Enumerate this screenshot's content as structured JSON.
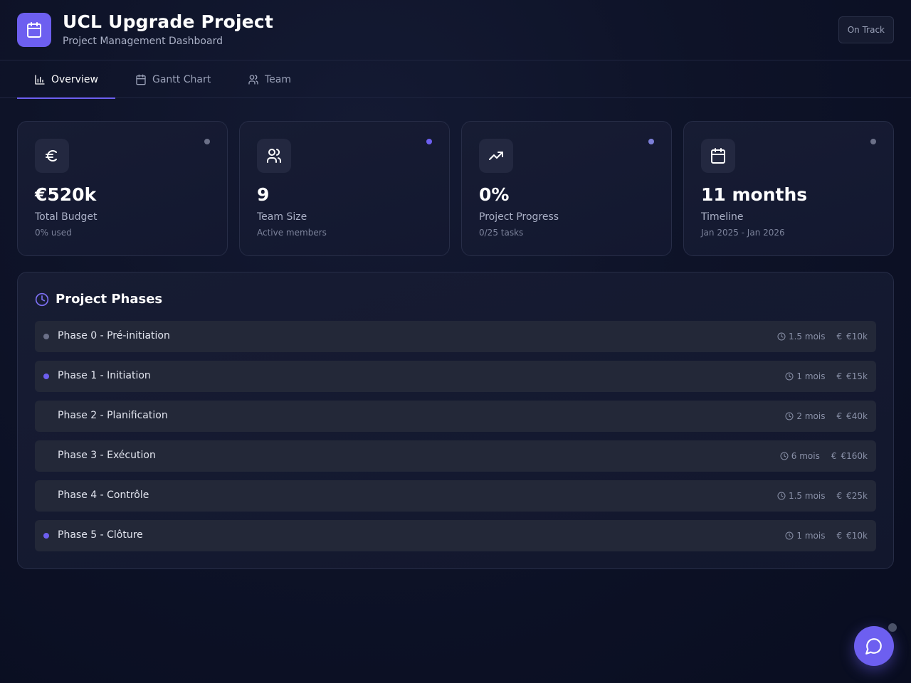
{
  "header": {
    "title": "UCL Upgrade Project",
    "subtitle": "Project Management Dashboard",
    "status": "On Track",
    "logo_icon": "calendar-icon"
  },
  "tabs": [
    {
      "label": "Overview",
      "icon": "bar-chart-icon",
      "active": true
    },
    {
      "label": "Gantt Chart",
      "icon": "calendar-icon",
      "active": false
    },
    {
      "label": "Team",
      "icon": "users-icon",
      "active": false
    }
  ],
  "stats": [
    {
      "icon": "euro-icon",
      "value": "€520k",
      "label": "Total Budget",
      "sub": "0% used",
      "dot_color": "#6b7088"
    },
    {
      "icon": "users-icon",
      "value": "9",
      "label": "Team Size",
      "sub": "Active members",
      "dot_color": "#6d5ff0"
    },
    {
      "icon": "trending-up-icon",
      "value": "0%",
      "label": "Project Progress",
      "sub": "0/25 tasks",
      "dot_color": "#7c7fd8"
    },
    {
      "icon": "calendar-icon",
      "value": "11 months",
      "label": "Timeline",
      "sub": "Jan 2025 - Jan 2026",
      "dot_color": "#6b7088"
    }
  ],
  "phases_panel": {
    "title": "Project Phases",
    "icon": "clock-icon",
    "phases": [
      {
        "name": "Phase 0 - Pré-initiation",
        "duration": "1.5 mois",
        "budget": "€10k",
        "dot_color": "#6b7088"
      },
      {
        "name": "Phase 1 - Initiation",
        "duration": "1 mois",
        "budget": "€15k",
        "dot_color": "#6d5ff0"
      },
      {
        "name": "Phase 2 - Planification",
        "duration": "2 mois",
        "budget": "€40k",
        "dot_color": ""
      },
      {
        "name": "Phase 3 - Exécution",
        "duration": "6 mois",
        "budget": "€160k",
        "dot_color": ""
      },
      {
        "name": "Phase 4 - Contrôle",
        "duration": "1.5 mois",
        "budget": "€25k",
        "dot_color": ""
      },
      {
        "name": "Phase 5 - Clôture",
        "duration": "1 mois",
        "budget": "€10k",
        "dot_color": "#6d5ff0"
      }
    ]
  },
  "chat": {
    "icon": "chat-bubble-icon"
  },
  "colors": {
    "accent": "#6d5ff0",
    "background": "#0e1328",
    "card": "#171c33"
  }
}
